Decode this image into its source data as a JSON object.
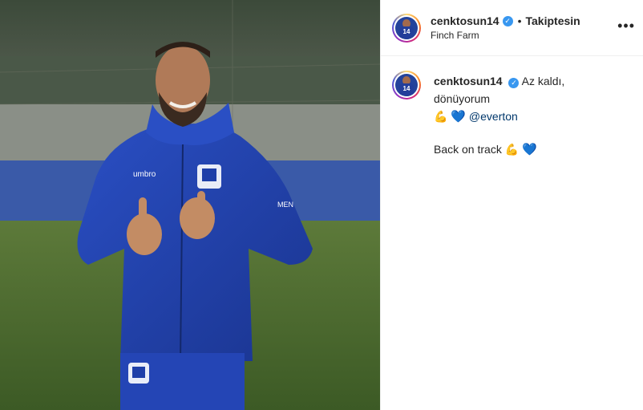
{
  "post": {
    "username": "cenktosun14",
    "follow_status": "Takiptesin",
    "location": "Finch Farm",
    "more_label": "•••",
    "caption": {
      "username": "cenktosun14",
      "text_line1": "Az kaldı, dönüyorum",
      "emoji_muscle": "💪",
      "emoji_heart": "💙",
      "mention": "@everton",
      "text_line2": "Back on track",
      "emoji_muscle2": "💪",
      "emoji_heart2": "💙"
    }
  },
  "photo": {
    "chest_letters": "umbro",
    "sleeve_text": "MEN",
    "jersey_number": "14"
  },
  "colors": {
    "jacket": "#1f3fa8",
    "grass": "#4f6e2e",
    "verified": "#3897f0",
    "mention": "#00376b"
  }
}
